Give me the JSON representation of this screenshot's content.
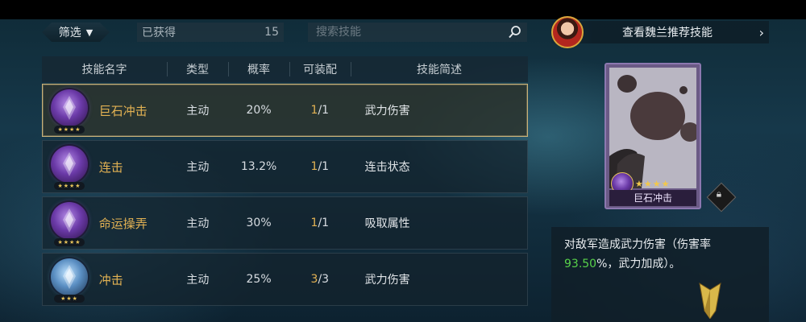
{
  "filter": {
    "label": "筛选",
    "caret": "▼"
  },
  "owned": {
    "label": "已获得",
    "count": "15"
  },
  "search": {
    "placeholder": "搜索技能",
    "icon": "search-icon"
  },
  "table": {
    "headers": [
      "技能名字",
      "类型",
      "概率",
      "可装配",
      "技能简述"
    ],
    "rows": [
      {
        "name": "巨石冲击",
        "type": "主动",
        "rate": "20%",
        "equip_cur": "1",
        "equip_total": "/1",
        "desc": "武力伤害",
        "stars": "★★★★",
        "selected": true,
        "icon_color": "purple"
      },
      {
        "name": "连击",
        "type": "主动",
        "rate": "13.2%",
        "equip_cur": "1",
        "equip_total": "/1",
        "desc": "连击状态",
        "stars": "★★★★",
        "selected": false,
        "icon_color": "purple"
      },
      {
        "name": "命运操弄",
        "type": "主动",
        "rate": "30%",
        "equip_cur": "1",
        "equip_total": "/1",
        "desc": "吸取属性",
        "stars": "★★★★",
        "selected": false,
        "icon_color": "purple"
      },
      {
        "name": "冲击",
        "type": "主动",
        "rate": "25%",
        "equip_cur": "3",
        "equip_total": "/3",
        "desc": "武力伤害",
        "stars": "★★★",
        "selected": false,
        "icon_color": "blue"
      }
    ]
  },
  "recommend": {
    "label": "查看魏兰推荐技能",
    "chevron": "›"
  },
  "card": {
    "name": "巨石冲击",
    "stars": "★★★★"
  },
  "detail": {
    "line1": "对敌军造成武力伤害（伤害率",
    "rate": "93.50",
    "line2": "%，武力加成）。"
  },
  "colors": {
    "gold": "#e3b253",
    "highlight_green": "#58d24a",
    "selected_border": "#c8b27a"
  }
}
